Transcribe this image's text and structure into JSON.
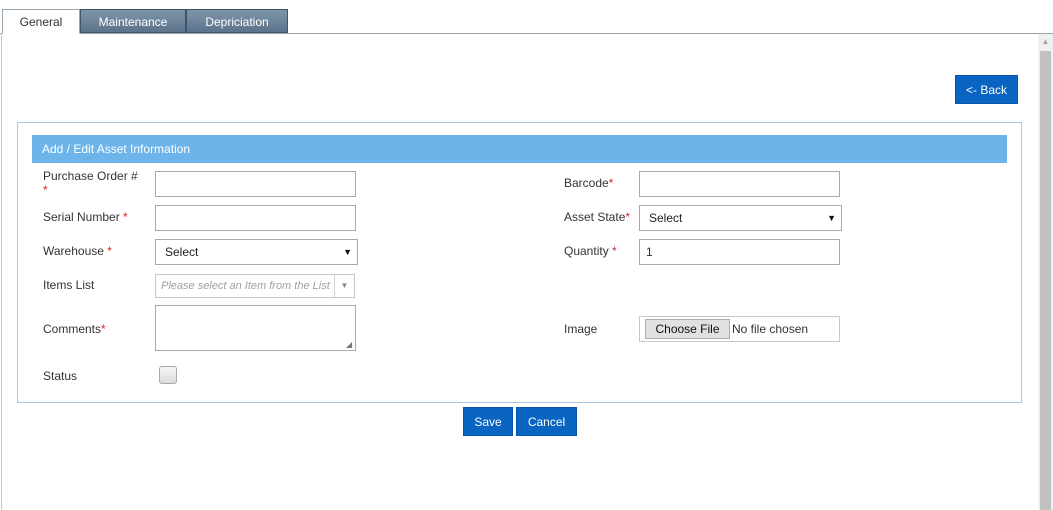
{
  "tabs": [
    {
      "label": "General",
      "active": true
    },
    {
      "label": "Maintenance",
      "active": false
    },
    {
      "label": "Depriciation",
      "active": false
    }
  ],
  "back_button": "<- Back",
  "panel_title": "Add / Edit Asset Information",
  "form": {
    "purchase_order": {
      "label": "Purchase Order #",
      "required_mark": "*",
      "value": ""
    },
    "serial_number": {
      "label": "Serial Number",
      "required_mark": "*",
      "value": ""
    },
    "warehouse": {
      "label": "Warehouse",
      "required_mark": "*",
      "selected": "Select"
    },
    "items_list": {
      "label": "Items List",
      "placeholder": "Please select an Item from the List"
    },
    "comments": {
      "label": "Comments",
      "required_mark": "*",
      "value": ""
    },
    "status": {
      "label": "Status",
      "checked": false
    },
    "barcode": {
      "label": "Barcode",
      "required_mark": "*",
      "value": ""
    },
    "asset_state": {
      "label": "Asset State",
      "required_mark": "*",
      "selected": "Select"
    },
    "quantity": {
      "label": "Quantity",
      "required_mark": "*",
      "value": "1"
    },
    "image": {
      "label": "Image",
      "button": "Choose File",
      "status": "No file chosen"
    }
  },
  "actions": {
    "save": "Save",
    "cancel": "Cancel"
  },
  "colors": {
    "accent": "#0a64c2",
    "panel_header": "#6cb4ea",
    "required": "#d9222a"
  },
  "icons": [
    "dropdown-arrow-icon",
    "resize-grip-icon",
    "scroll-up-icon"
  ]
}
